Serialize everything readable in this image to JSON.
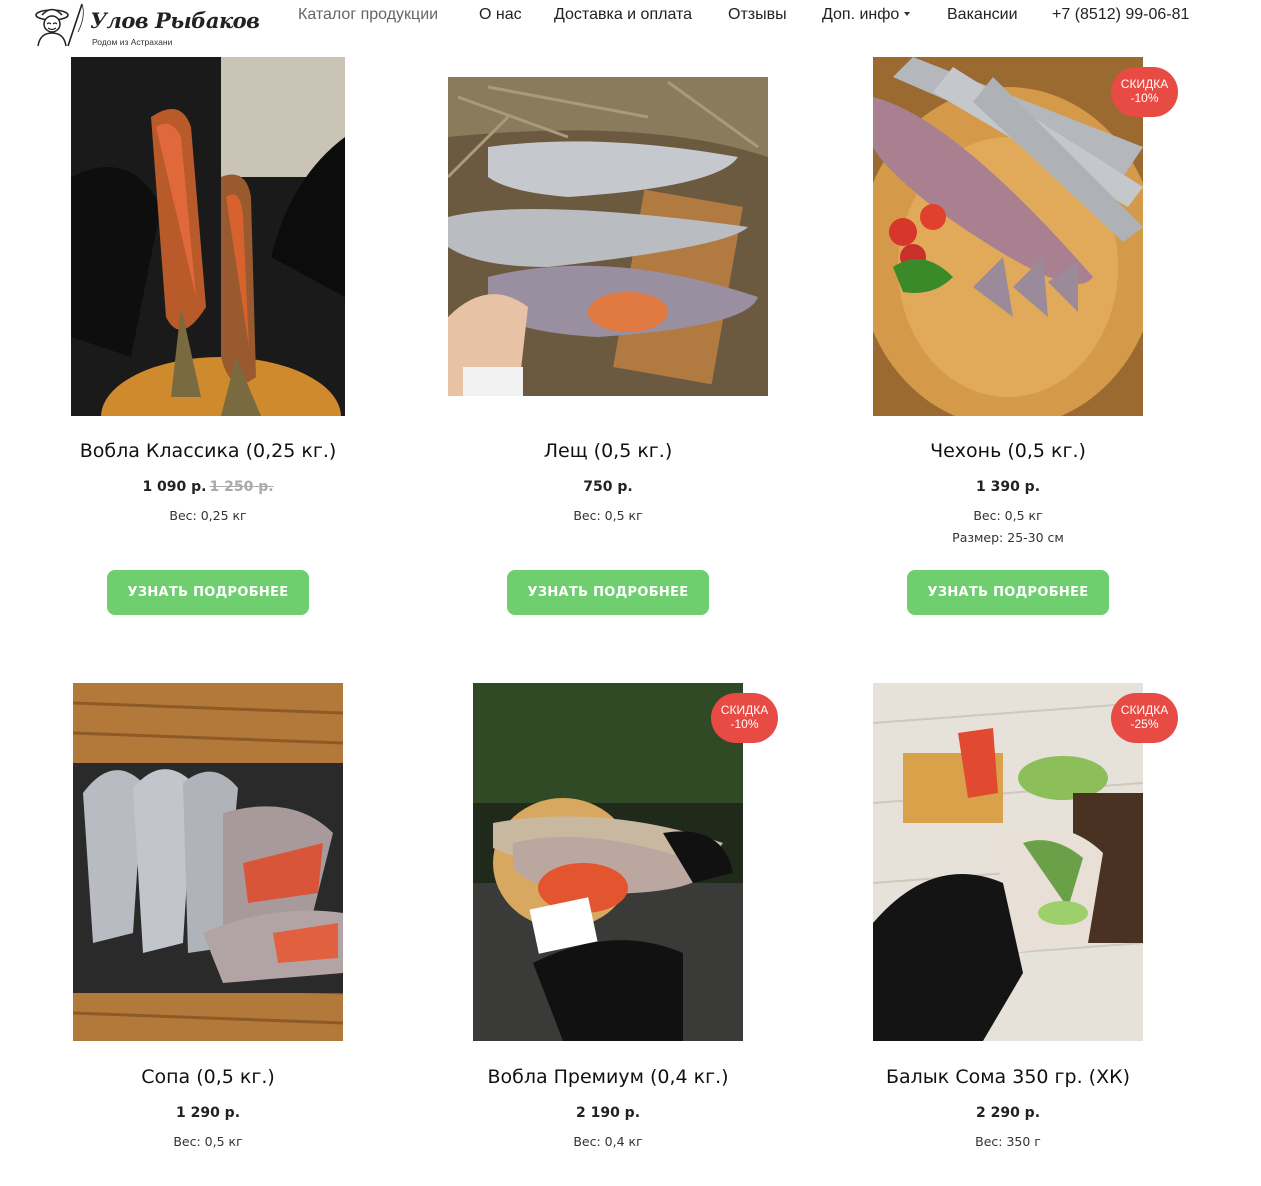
{
  "header": {
    "logo_title": "Улов Рыбаков",
    "logo_subtitle": "Родом из Астрахани",
    "nav": [
      {
        "label": "Каталог продукции"
      },
      {
        "label": "О нас"
      },
      {
        "label": "Доставка и оплата"
      },
      {
        "label": "Отзывы"
      },
      {
        "label": "Доп. инфо"
      },
      {
        "label": "Вакансии"
      },
      {
        "label": "+7 (8512) 99-06-81"
      }
    ]
  },
  "products": [
    {
      "title": "Вобла Классика (0,25 кг.)",
      "price": "1 090 р.",
      "old_price": "1 250 р.",
      "specs": [
        "Вес: 0,25 кг"
      ],
      "button": "УЗНАТЬ ПОДРОБНЕЕ"
    },
    {
      "title": "Лещ (0,5 кг.)",
      "price": "750 р.",
      "specs": [
        "Вес: 0,5 кг"
      ],
      "button": "УЗНАТЬ ПОДРОБНЕЕ"
    },
    {
      "title": "Чехонь (0,5 кг.)",
      "price": "1 390 р.",
      "specs": [
        "Вес: 0,5 кг",
        "Размер: 25-30 см"
      ],
      "button": "УЗНАТЬ ПОДРОБНЕЕ",
      "badge": [
        "СКИДКА",
        "-10%"
      ]
    },
    {
      "title": "Сопа (0,5 кг.)",
      "price": "1 290 р.",
      "specs": [
        "Вес: 0,5 кг"
      ]
    },
    {
      "title": "Вобла Премиум (0,4 кг.)",
      "price": "2 190 р.",
      "specs": [
        "Вес: 0,4 кг"
      ],
      "badge": [
        "СКИДКА",
        "-10%"
      ]
    },
    {
      "title": "Балык Сома 350 гр. (ХК)",
      "price": "2 290 р.",
      "specs": [
        "Вес: 350 г"
      ],
      "badge": [
        "СКИДКА",
        "-25%"
      ]
    }
  ],
  "colors": {
    "button": "#6fcf6f",
    "badge": "#e84b43",
    "old_price": "#aaaaaa"
  }
}
